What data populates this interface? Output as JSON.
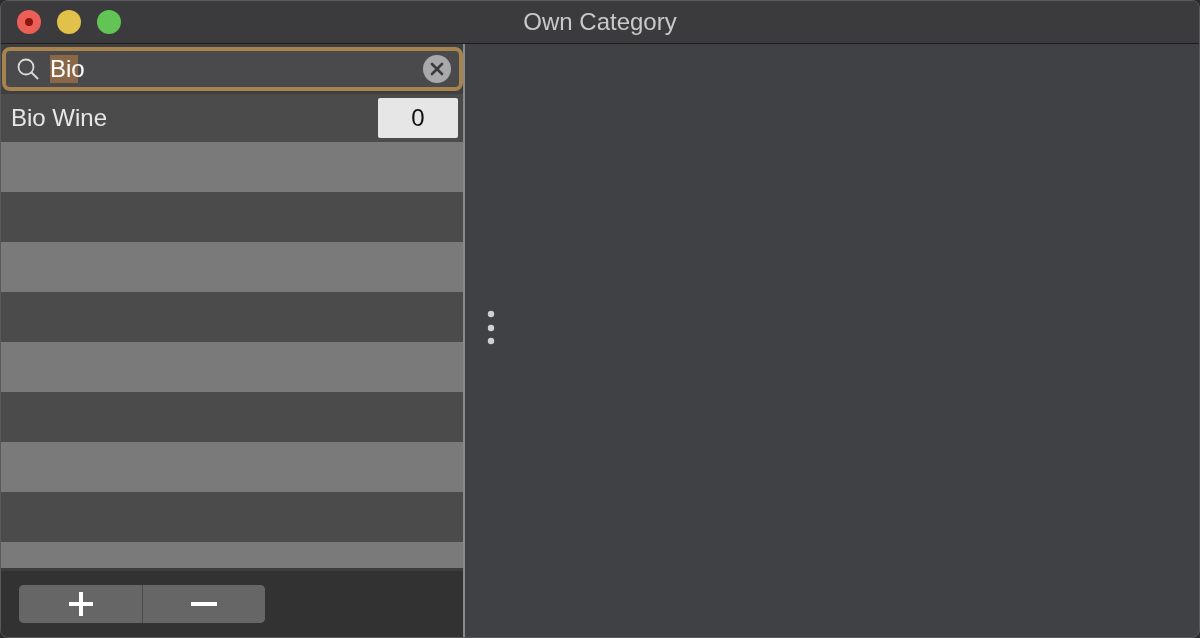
{
  "window": {
    "title": "Own Category"
  },
  "search": {
    "value": "Bio",
    "focused": true,
    "text_selected": true
  },
  "rows": [
    {
      "name": "Bio Wine",
      "count": "0"
    }
  ]
}
